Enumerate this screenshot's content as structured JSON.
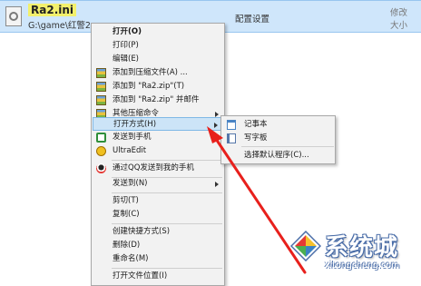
{
  "file": {
    "name": "Ra2.ini",
    "path": "G:\\game\\红警2",
    "type": "配置设置",
    "modified_label": "修改",
    "size_label": "大小"
  },
  "context_menu": {
    "items": [
      {
        "label": "打开(O)",
        "icon": null,
        "bold": true
      },
      {
        "label": "打印(P)",
        "icon": null
      },
      {
        "label": "编辑(E)",
        "icon": null
      },
      {
        "label": "添加到压缩文件(A) ...",
        "icon": "archive-icon"
      },
      {
        "label": "添加到 \"Ra2.zip\"(T)",
        "icon": "archive-icon"
      },
      {
        "label": "添加到 \"Ra2.zip\" 并邮件",
        "icon": "archive-icon"
      },
      {
        "label": "其他压缩命令",
        "icon": "archive-icon",
        "submenu": true
      },
      {
        "label": "打开方式(H)",
        "icon": null,
        "submenu": true,
        "highlighted": true
      },
      {
        "label": "发送到手机",
        "icon": "phone-icon"
      },
      {
        "label": "UltraEdit",
        "icon": "ultraedit-icon"
      },
      {
        "label": "通过QQ发送到我的手机",
        "icon": "qq-icon"
      },
      {
        "label": "发送到(N)",
        "icon": null,
        "submenu": true
      },
      {
        "label": "剪切(T)",
        "icon": null
      },
      {
        "label": "复制(C)",
        "icon": null
      },
      {
        "label": "创建快捷方式(S)",
        "icon": null
      },
      {
        "label": "删除(D)",
        "icon": null
      },
      {
        "label": "重命名(M)",
        "icon": null
      },
      {
        "label": "打开文件位置(I)",
        "icon": null
      }
    ]
  },
  "open_with_submenu": {
    "items": [
      {
        "label": "记事本",
        "icon": "notepad-icon"
      },
      {
        "label": "写字板",
        "icon": "wordpad-icon"
      },
      {
        "label": "选择默认程序(C)...",
        "icon": null
      }
    ]
  },
  "annotation": {
    "color": "#e8201c"
  },
  "watermark": {
    "title": "系统城",
    "domain": "xitongcheng.com"
  },
  "colors": {
    "selection_bg": "#cfe6fb",
    "menu_bg": "#f2f2f2",
    "highlight_bg": "#cce4f7"
  }
}
